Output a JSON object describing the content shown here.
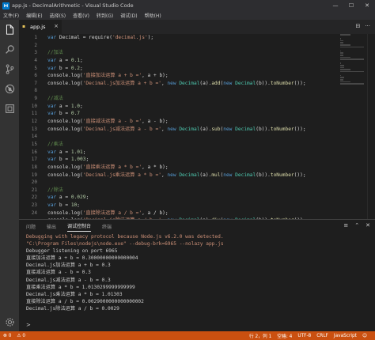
{
  "window": {
    "title": "app.js - DecimalArithmetic - Visual Studio Code",
    "minimize": "—",
    "maximize": "☐",
    "close": "✕"
  },
  "menu": [
    "文件(F)",
    "编辑(E)",
    "选择(S)",
    "查看(V)",
    "转到(G)",
    "调试(D)",
    "帮助(H)"
  ],
  "activity_icons": [
    "files-icon",
    "search-icon",
    "git-icon",
    "debug-icon",
    "extensions-icon",
    "settings-gear-icon"
  ],
  "tab": {
    "label": "app.js",
    "close": "×"
  },
  "tab_actions": [
    "⊟",
    "···"
  ],
  "editor": {
    "line_numbers": [
      "1",
      "2",
      "3",
      "4",
      "5",
      "6",
      "7",
      "8",
      "9",
      "10",
      "11",
      "12",
      "13",
      "14",
      "15",
      "16",
      "17",
      "18",
      "19",
      "20",
      "21",
      "22",
      "23",
      "24"
    ],
    "lines": [
      [
        {
          "t": "var ",
          "c": "kw"
        },
        {
          "t": "Decimal = require(",
          "c": ""
        },
        {
          "t": "'decimal.js'",
          "c": "str"
        },
        {
          "t": ");",
          "c": ""
        }
      ],
      [],
      [
        {
          "t": "//加法",
          "c": "cmt"
        }
      ],
      [
        {
          "t": "var ",
          "c": "kw"
        },
        {
          "t": "a = ",
          "c": ""
        },
        {
          "t": "0.1",
          "c": "num"
        },
        {
          "t": ";",
          "c": ""
        }
      ],
      [
        {
          "t": "var ",
          "c": "kw"
        },
        {
          "t": "b = ",
          "c": ""
        },
        {
          "t": "0.2",
          "c": "num"
        },
        {
          "t": ";",
          "c": ""
        }
      ],
      [
        {
          "t": "console.log(",
          "c": ""
        },
        {
          "t": "'直接加法运算 a + b ='",
          "c": "str"
        },
        {
          "t": ", a + b);",
          "c": ""
        }
      ],
      [
        {
          "t": "console.log(",
          "c": ""
        },
        {
          "t": "'Decimal.js加法运算 a + b ='",
          "c": "str"
        },
        {
          "t": ", ",
          "c": ""
        },
        {
          "t": "new ",
          "c": "kw"
        },
        {
          "t": "Decimal",
          "c": "cls"
        },
        {
          "t": "(a).",
          "c": ""
        },
        {
          "t": "add",
          "c": "fn"
        },
        {
          "t": "(",
          "c": ""
        },
        {
          "t": "new ",
          "c": "kw"
        },
        {
          "t": "Decimal",
          "c": "cls"
        },
        {
          "t": "(b)).",
          "c": ""
        },
        {
          "t": "toNumber",
          "c": "fn"
        },
        {
          "t": "());",
          "c": ""
        }
      ],
      [],
      [
        {
          "t": "//减法",
          "c": "cmt"
        }
      ],
      [
        {
          "t": "var ",
          "c": "kw"
        },
        {
          "t": "a = ",
          "c": ""
        },
        {
          "t": "1.0",
          "c": "num"
        },
        {
          "t": ";",
          "c": ""
        }
      ],
      [
        {
          "t": "var ",
          "c": "kw"
        },
        {
          "t": "b = ",
          "c": ""
        },
        {
          "t": "0.7",
          "c": "num"
        }
      ],
      [
        {
          "t": "console.log(",
          "c": ""
        },
        {
          "t": "'直接减法运算 a - b ='",
          "c": "str"
        },
        {
          "t": ", a - b);",
          "c": ""
        }
      ],
      [
        {
          "t": "console.log(",
          "c": ""
        },
        {
          "t": "'Decimal.js减法运算 a - b ='",
          "c": "str"
        },
        {
          "t": ", ",
          "c": ""
        },
        {
          "t": "new ",
          "c": "kw"
        },
        {
          "t": "Decimal",
          "c": "cls"
        },
        {
          "t": "(a).",
          "c": ""
        },
        {
          "t": "sub",
          "c": "fn"
        },
        {
          "t": "(",
          "c": ""
        },
        {
          "t": "new ",
          "c": "kw"
        },
        {
          "t": "Decimal",
          "c": "cls"
        },
        {
          "t": "(b)).",
          "c": ""
        },
        {
          "t": "toNumber",
          "c": "fn"
        },
        {
          "t": "());",
          "c": ""
        }
      ],
      [],
      [
        {
          "t": "//乘法",
          "c": "cmt"
        }
      ],
      [
        {
          "t": "var ",
          "c": "kw"
        },
        {
          "t": "a = ",
          "c": ""
        },
        {
          "t": "1.01",
          "c": "num"
        },
        {
          "t": ";",
          "c": ""
        }
      ],
      [
        {
          "t": "var ",
          "c": "kw"
        },
        {
          "t": "b = ",
          "c": ""
        },
        {
          "t": "1.003",
          "c": "num"
        },
        {
          "t": ";",
          "c": ""
        }
      ],
      [
        {
          "t": "console.log(",
          "c": ""
        },
        {
          "t": "'直接乘法运算 a * b ='",
          "c": "str"
        },
        {
          "t": ", a * b);",
          "c": ""
        }
      ],
      [
        {
          "t": "console.log(",
          "c": ""
        },
        {
          "t": "'Decimal.js乘法运算 a * b ='",
          "c": "str"
        },
        {
          "t": ", ",
          "c": ""
        },
        {
          "t": "new ",
          "c": "kw"
        },
        {
          "t": "Decimal",
          "c": "cls"
        },
        {
          "t": "(a).",
          "c": ""
        },
        {
          "t": "mul",
          "c": "fn"
        },
        {
          "t": "(",
          "c": ""
        },
        {
          "t": "new ",
          "c": "kw"
        },
        {
          "t": "Decimal",
          "c": "cls"
        },
        {
          "t": "(b)).",
          "c": ""
        },
        {
          "t": "toNumber",
          "c": "fn"
        },
        {
          "t": "());",
          "c": ""
        }
      ],
      [],
      [
        {
          "t": "//除法",
          "c": "cmt"
        }
      ],
      [
        {
          "t": "var ",
          "c": "kw"
        },
        {
          "t": "a = ",
          "c": ""
        },
        {
          "t": "0.029",
          "c": "num"
        },
        {
          "t": ";",
          "c": ""
        }
      ],
      [
        {
          "t": "var ",
          "c": "kw"
        },
        {
          "t": "b = ",
          "c": ""
        },
        {
          "t": "10",
          "c": "num"
        },
        {
          "t": ";",
          "c": ""
        }
      ],
      [
        {
          "t": "console.log(",
          "c": ""
        },
        {
          "t": "'直接除法运算 a / b ='",
          "c": "str"
        },
        {
          "t": ", a / b);",
          "c": ""
        }
      ],
      [
        {
          "t": "console.log(",
          "c": ""
        },
        {
          "t": "'Decimal.js除法运算 a / b ='",
          "c": "str"
        },
        {
          "t": ", ",
          "c": ""
        },
        {
          "t": "new ",
          "c": "kw"
        },
        {
          "t": "Decimal",
          "c": "cls"
        },
        {
          "t": "(a).",
          "c": ""
        },
        {
          "t": "div",
          "c": "fn"
        },
        {
          "t": "(",
          "c": ""
        },
        {
          "t": "new ",
          "c": "kw"
        },
        {
          "t": "Decimal",
          "c": "cls"
        },
        {
          "t": "(b)).",
          "c": ""
        },
        {
          "t": "toNumber",
          "c": "fn"
        },
        {
          "t": "());",
          "c": ""
        }
      ]
    ]
  },
  "panel": {
    "tabs": [
      "问题",
      "输出",
      "调试控制台",
      "终端"
    ],
    "active_tab": 2,
    "actions": [
      "≡",
      "⌃",
      "✕"
    ],
    "console_lines": [
      {
        "text": "Debugging with legacy protocol because Node.js v6.2.0 was detected.",
        "warn": true
      },
      {
        "text": "\"C:\\Program Files\\nodejs\\node.exe\" --debug-brk=6965 --nolazy app.js",
        "warn": true
      },
      {
        "text": "Debugger listening on port 6965",
        "warn": false
      },
      {
        "text": "直接加法运算 a + b = 0.30000000000000004",
        "warn": false
      },
      {
        "text": "Decimal.js加法运算 a + b = 0.3",
        "warn": false
      },
      {
        "text": "直接减法运算 a - b = 0.3",
        "warn": false
      },
      {
        "text": "Decimal.js减法运算 a - b = 0.3",
        "warn": false
      },
      {
        "text": "直接乘法运算 a * b = 1.0130299999999999",
        "warn": false
      },
      {
        "text": "Decimal.js乘法运算 a * b = 1.01303",
        "warn": false
      },
      {
        "text": "直接除法运算 a / b = 0.0029000000000000002",
        "warn": false
      },
      {
        "text": "Decimal.js除法运算 a / b = 0.0029",
        "warn": false
      }
    ],
    "prompt": ">"
  },
  "status": {
    "left": [
      "⊗ 0",
      "⚠ 0"
    ],
    "right": [
      "行 2，列 1",
      "空格: 4",
      "UTF-8",
      "CRLF",
      "JavaScript",
      "☺"
    ]
  },
  "colors": {
    "status_bar": "#ca5010",
    "accent": "#007acc"
  }
}
